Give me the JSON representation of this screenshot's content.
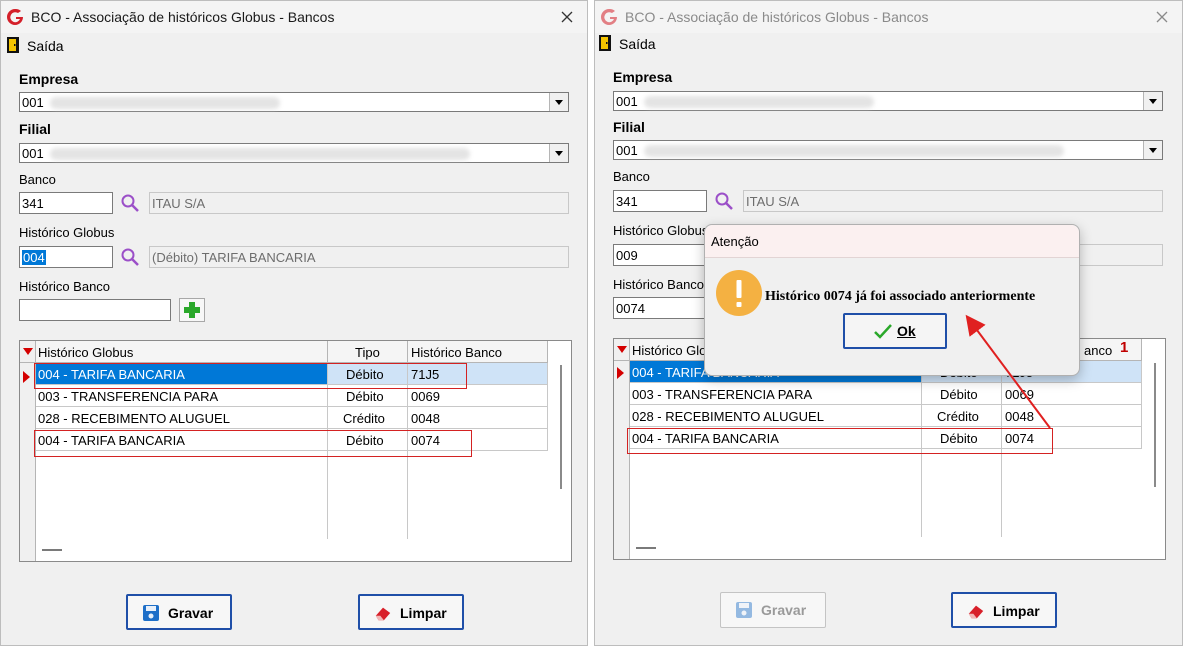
{
  "window_title": "BCO - Associação de históricos Globus - Bancos",
  "menu": {
    "exit_label": "Saída"
  },
  "labels": {
    "empresa": "Empresa",
    "filial": "Filial",
    "banco": "Banco",
    "historico_globus": "Histórico Globus",
    "historico_banco": "Histórico Banco"
  },
  "panel_left": {
    "empresa_code": "001",
    "filial_code": "001",
    "banco_code": "341",
    "banco_name": "ITAU S/A",
    "historico_globus_code": "004",
    "historico_globus_desc": "(Débito) TARIFA BANCARIA",
    "historico_banco_value": ""
  },
  "panel_right": {
    "empresa_code": "001",
    "filial_code": "001",
    "banco_code": "341",
    "banco_name": "ITAU S/A",
    "historico_globus_code": "009",
    "historico_banco_value": "0074",
    "label_historico_globus_partial": "Histórico Globus",
    "label_historico_banco_partial": "Histórico Banco",
    "grid_hdr_hist_partial": "Histórico Glo",
    "grid_hdr_banco_partial": "anco",
    "sort_indicator": "1"
  },
  "grid": {
    "columns": [
      "Histórico Globus",
      "Tipo",
      "Histórico Banco"
    ],
    "rows": [
      {
        "historico": "004 - TARIFA BANCARIA",
        "tipo": "Débito",
        "banco": "71J5"
      },
      {
        "historico": "003 - TRANSFERENCIA PARA",
        "tipo": "Débito",
        "banco": "0069"
      },
      {
        "historico": "028 - RECEBIMENTO ALUGUEL",
        "tipo": "Crédito",
        "banco": "0048"
      },
      {
        "historico": "004 - TARIFA BANCARIA",
        "tipo": "Débito",
        "banco": "0074"
      }
    ]
  },
  "buttons": {
    "save": "Gravar",
    "clear": "Limpar"
  },
  "dialog": {
    "title": "Atenção",
    "message": "Histórico 0074 já foi associado anteriormente",
    "ok_label": "Ok"
  },
  "colors": {
    "selection": "#0078d7",
    "highlight": "#d42222",
    "button_border": "#1f4fa8",
    "warning": "#f5a623"
  }
}
